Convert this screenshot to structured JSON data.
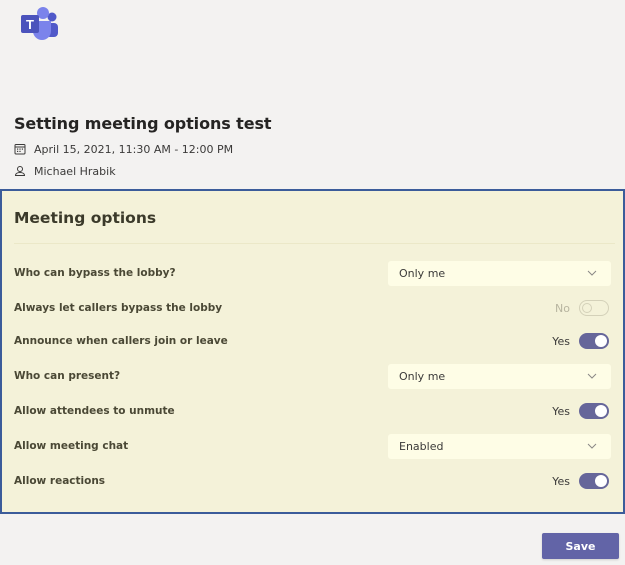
{
  "app": {
    "logo_icon": "microsoft-teams-logo",
    "logo_letter": "T"
  },
  "meeting": {
    "title": "Setting meeting options test",
    "datetime": "April 15, 2021, 11:30 AM - 12:00 PM",
    "datetime_icon": "calendar-icon",
    "organizer": "Michael Hrabik",
    "organizer_icon": "person-icon"
  },
  "options_panel": {
    "title": "Meeting options",
    "options": [
      {
        "label": "Who can bypass the lobby?",
        "type": "select",
        "value": "Only me"
      },
      {
        "label": "Always let callers bypass the lobby",
        "type": "toggle",
        "state": "No",
        "on": false,
        "disabled": true
      },
      {
        "label": "Announce when callers join or leave",
        "type": "toggle",
        "state": "Yes",
        "on": true
      },
      {
        "label": "Who can present?",
        "type": "select",
        "value": "Only me"
      },
      {
        "label": "Allow attendees to unmute",
        "type": "toggle",
        "state": "Yes",
        "on": true
      },
      {
        "label": "Allow meeting chat",
        "type": "select",
        "value": "Enabled"
      },
      {
        "label": "Allow reactions",
        "type": "toggle",
        "state": "Yes",
        "on": true
      }
    ]
  },
  "footer": {
    "save_label": "Save"
  },
  "colors": {
    "accent": "#6264a7",
    "panel_bg": "#f4f2d9",
    "panel_border": "#3b5c9a",
    "page_bg": "#f3f2f1"
  }
}
